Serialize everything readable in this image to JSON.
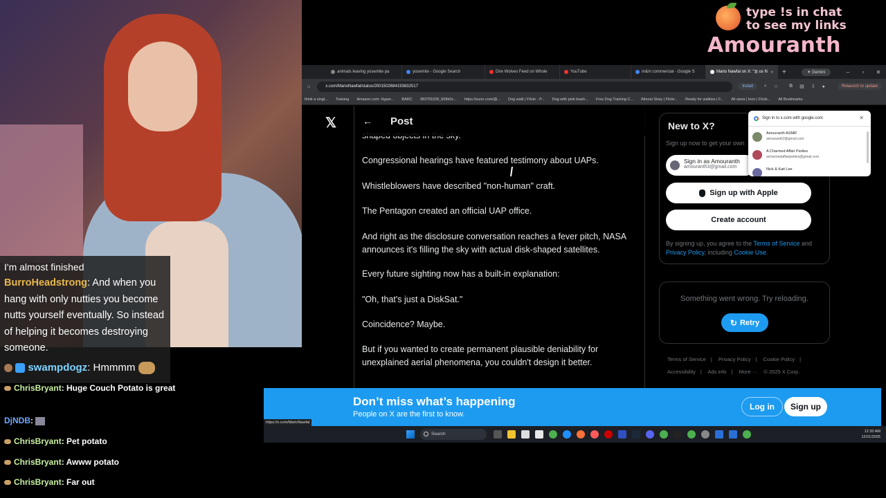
{
  "overlay": {
    "promo_line1": "type !s in chat",
    "promo_line2": "to see my links",
    "streamer_name": "Amouranth"
  },
  "chat": {
    "box_lines": [
      {
        "user": "",
        "text": "I'm almost finished"
      },
      {
        "user": "BurroHeadstrong",
        "text": ": And when you hang with only nutties you become nutts yourself eventually. So instead of helping it becomes destroying someone."
      },
      {
        "user": "swampdogz",
        "text": ": Hmmmm"
      }
    ],
    "user_colors": {
      "BurroHeadstrong": "#e8b84a",
      "swampdogz": "#7fd3ff",
      "ChrisBryant": "#c8f0a0",
      "DjNDB": "#6fa8ff"
    },
    "lower": [
      {
        "user": "ChrisBryant",
        "text": ": Huge Couch Potato is great"
      },
      {
        "user": "DjNDB",
        "text": ":"
      },
      {
        "user": "ChrisBryant",
        "text": ": Pet potato"
      },
      {
        "user": "ChrisBryant",
        "text": ": Awww potato"
      },
      {
        "user": "ChrisBryant",
        "text": ": Far out"
      }
    ]
  },
  "browser": {
    "tabs": [
      {
        "label": "animals leaving yosemite pa",
        "active": false
      },
      {
        "label": "yosemite - Google Search",
        "active": false
      },
      {
        "label": "Dire Wolves Feed on Whole",
        "active": false
      },
      {
        "label": "YouTube",
        "active": false
      },
      {
        "label": "m&m commercial - Google S",
        "active": false
      },
      {
        "label": "Mario Nawfal on X: \"🇧 us N",
        "active": true
      }
    ],
    "gemini_label": "Gemini",
    "url": "x.com/MarioNawfal/status/2001502684193632517",
    "install_label": "Install",
    "relaunch_label": "Relaunch to update",
    "bookmarks": [
      "think a singl...",
      "Training",
      "Amazon.com: Hyper...",
      "BARC",
      "383781028_669b3c...",
      "https://suno.com/@...",
      "Dog walk | Flickr - P...",
      "Dog with pink leash...",
      "Free Dog Training C...",
      "Almost Stray | Flickr...",
      "Ready for walkies | F...",
      "All sizes | leon | Flickr...",
      "All Bookmarks"
    ]
  },
  "post": {
    "title": "Post",
    "paragraphs": [
      "shaped objects in the sky.",
      "Congressional hearings have featured testimony about UAPs.",
      "Whistleblowers have described \"non-human\" craft.",
      "The Pentagon created an official UAP office.",
      "And right as the disclosure conversation reaches a fever pitch, NASA announces it's filling the sky with actual disk-shaped satellites.",
      "Every future sighting now has a built-in explanation:",
      "\"Oh, that's just a DiskSat.\"",
      "Coincidence? Maybe.",
      "But if you wanted to create permanent plausible deniability for unexplained aerial phenomena, you couldn't design it better."
    ]
  },
  "sidebar": {
    "new_title": "New to X?",
    "new_sub": "Sign up now to get your own",
    "google_signin_name": "Sign in as Amouranth",
    "google_signin_email": "amouranth3@gmail.com",
    "apple_label": "Sign up with Apple",
    "create_label": "Create account",
    "terms_pre": "By signing up, you agree to the ",
    "terms_link": "Terms of Service",
    "terms_and": " and ",
    "privacy_link": "Privacy Policy",
    "terms_incl": ", including ",
    "cookie_link": "Cookie Use.",
    "error_msg": "Something went wrong. Try reloading.",
    "retry_label": "Retry",
    "footer": [
      "Terms of Service",
      "|",
      "Privacy Policy",
      "|",
      "Cookie Policy",
      "|",
      "Accessibility",
      "|",
      "Ads info",
      "|",
      "More ···",
      "© 2025 X Corp."
    ]
  },
  "google_popup": {
    "header": "Sign in to x.com with google.com",
    "accounts": [
      {
        "name": "Amouranth ASMR",
        "email": "amouranth3@gmail.com",
        "color": "#7a8a6a"
      },
      {
        "name": "A Charmed Affair Parties",
        "email": "acharmedaffairparties@gmail.com",
        "color": "#b04a5a"
      },
      {
        "name": "Nick & Kait Lee",
        "email": "",
        "color": "#6a6aa0"
      }
    ]
  },
  "banner": {
    "title": "Don’t miss what’s happening",
    "subtitle": "People on X are the first to know.",
    "login_label": "Log in",
    "signup_label": "Sign up",
    "status_url": "https://x.com/MarioNawfal"
  },
  "taskbar": {
    "search_label": "Search",
    "time": "12:30 AM",
    "date": "12/21/2025"
  }
}
